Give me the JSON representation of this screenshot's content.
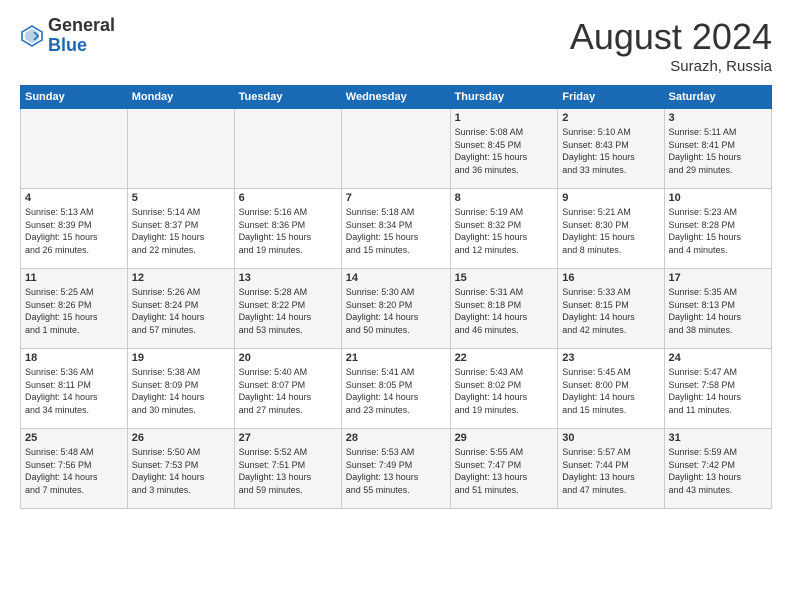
{
  "header": {
    "logo_general": "General",
    "logo_blue": "Blue",
    "month_title": "August 2024",
    "subtitle": "Surazh, Russia"
  },
  "columns": [
    "Sunday",
    "Monday",
    "Tuesday",
    "Wednesday",
    "Thursday",
    "Friday",
    "Saturday"
  ],
  "weeks": [
    [
      {
        "day": "",
        "info": ""
      },
      {
        "day": "",
        "info": ""
      },
      {
        "day": "",
        "info": ""
      },
      {
        "day": "",
        "info": ""
      },
      {
        "day": "1",
        "info": "Sunrise: 5:08 AM\nSunset: 8:45 PM\nDaylight: 15 hours\nand 36 minutes."
      },
      {
        "day": "2",
        "info": "Sunrise: 5:10 AM\nSunset: 8:43 PM\nDaylight: 15 hours\nand 33 minutes."
      },
      {
        "day": "3",
        "info": "Sunrise: 5:11 AM\nSunset: 8:41 PM\nDaylight: 15 hours\nand 29 minutes."
      }
    ],
    [
      {
        "day": "4",
        "info": "Sunrise: 5:13 AM\nSunset: 8:39 PM\nDaylight: 15 hours\nand 26 minutes."
      },
      {
        "day": "5",
        "info": "Sunrise: 5:14 AM\nSunset: 8:37 PM\nDaylight: 15 hours\nand 22 minutes."
      },
      {
        "day": "6",
        "info": "Sunrise: 5:16 AM\nSunset: 8:36 PM\nDaylight: 15 hours\nand 19 minutes."
      },
      {
        "day": "7",
        "info": "Sunrise: 5:18 AM\nSunset: 8:34 PM\nDaylight: 15 hours\nand 15 minutes."
      },
      {
        "day": "8",
        "info": "Sunrise: 5:19 AM\nSunset: 8:32 PM\nDaylight: 15 hours\nand 12 minutes."
      },
      {
        "day": "9",
        "info": "Sunrise: 5:21 AM\nSunset: 8:30 PM\nDaylight: 15 hours\nand 8 minutes."
      },
      {
        "day": "10",
        "info": "Sunrise: 5:23 AM\nSunset: 8:28 PM\nDaylight: 15 hours\nand 4 minutes."
      }
    ],
    [
      {
        "day": "11",
        "info": "Sunrise: 5:25 AM\nSunset: 8:26 PM\nDaylight: 15 hours\nand 1 minute."
      },
      {
        "day": "12",
        "info": "Sunrise: 5:26 AM\nSunset: 8:24 PM\nDaylight: 14 hours\nand 57 minutes."
      },
      {
        "day": "13",
        "info": "Sunrise: 5:28 AM\nSunset: 8:22 PM\nDaylight: 14 hours\nand 53 minutes."
      },
      {
        "day": "14",
        "info": "Sunrise: 5:30 AM\nSunset: 8:20 PM\nDaylight: 14 hours\nand 50 minutes."
      },
      {
        "day": "15",
        "info": "Sunrise: 5:31 AM\nSunset: 8:18 PM\nDaylight: 14 hours\nand 46 minutes."
      },
      {
        "day": "16",
        "info": "Sunrise: 5:33 AM\nSunset: 8:15 PM\nDaylight: 14 hours\nand 42 minutes."
      },
      {
        "day": "17",
        "info": "Sunrise: 5:35 AM\nSunset: 8:13 PM\nDaylight: 14 hours\nand 38 minutes."
      }
    ],
    [
      {
        "day": "18",
        "info": "Sunrise: 5:36 AM\nSunset: 8:11 PM\nDaylight: 14 hours\nand 34 minutes."
      },
      {
        "day": "19",
        "info": "Sunrise: 5:38 AM\nSunset: 8:09 PM\nDaylight: 14 hours\nand 30 minutes."
      },
      {
        "day": "20",
        "info": "Sunrise: 5:40 AM\nSunset: 8:07 PM\nDaylight: 14 hours\nand 27 minutes."
      },
      {
        "day": "21",
        "info": "Sunrise: 5:41 AM\nSunset: 8:05 PM\nDaylight: 14 hours\nand 23 minutes."
      },
      {
        "day": "22",
        "info": "Sunrise: 5:43 AM\nSunset: 8:02 PM\nDaylight: 14 hours\nand 19 minutes."
      },
      {
        "day": "23",
        "info": "Sunrise: 5:45 AM\nSunset: 8:00 PM\nDaylight: 14 hours\nand 15 minutes."
      },
      {
        "day": "24",
        "info": "Sunrise: 5:47 AM\nSunset: 7:58 PM\nDaylight: 14 hours\nand 11 minutes."
      }
    ],
    [
      {
        "day": "25",
        "info": "Sunrise: 5:48 AM\nSunset: 7:56 PM\nDaylight: 14 hours\nand 7 minutes."
      },
      {
        "day": "26",
        "info": "Sunrise: 5:50 AM\nSunset: 7:53 PM\nDaylight: 14 hours\nand 3 minutes."
      },
      {
        "day": "27",
        "info": "Sunrise: 5:52 AM\nSunset: 7:51 PM\nDaylight: 13 hours\nand 59 minutes."
      },
      {
        "day": "28",
        "info": "Sunrise: 5:53 AM\nSunset: 7:49 PM\nDaylight: 13 hours\nand 55 minutes."
      },
      {
        "day": "29",
        "info": "Sunrise: 5:55 AM\nSunset: 7:47 PM\nDaylight: 13 hours\nand 51 minutes."
      },
      {
        "day": "30",
        "info": "Sunrise: 5:57 AM\nSunset: 7:44 PM\nDaylight: 13 hours\nand 47 minutes."
      },
      {
        "day": "31",
        "info": "Sunrise: 5:59 AM\nSunset: 7:42 PM\nDaylight: 13 hours\nand 43 minutes."
      }
    ]
  ]
}
